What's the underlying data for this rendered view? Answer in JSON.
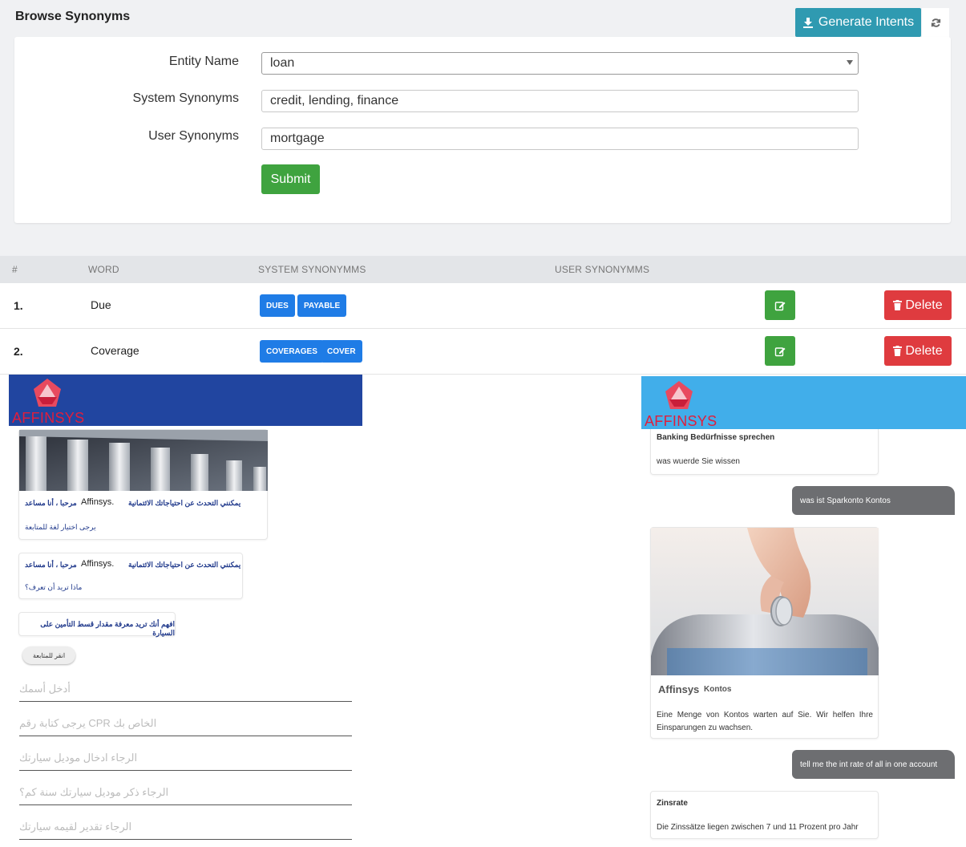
{
  "page": {
    "title": "Browse Synonyms",
    "generate_label": "Generate Intents"
  },
  "form": {
    "entity_label": "Entity Name",
    "entity_value": "loan",
    "system_label": "System Synonyms",
    "system_value": "credit, lending, finance",
    "user_label": "User Synonyms",
    "user_value": "mortgage",
    "submit_label": "Submit"
  },
  "table": {
    "headers": [
      "#",
      "WORD",
      "SYSTEM SYNONYMMS",
      "USER SYNONYMMS"
    ],
    "rows": [
      {
        "num": "1.",
        "word": "Due",
        "chips": [
          "DUES",
          "PAYABLE"
        ],
        "delete_label": "Delete"
      },
      {
        "num": "2.",
        "word": "Coverage",
        "chips": [
          "COVERAGES",
          "COVER"
        ],
        "delete_label": "Delete"
      }
    ]
  },
  "colors": {
    "arabic_header": "#2145a0",
    "german_header": "#41aeea",
    "logo_red": "#e01e3c",
    "primary": "#1f7ce6",
    "success": "#3fa33f",
    "danger": "#df3b3f",
    "teal": "#2f9ab1"
  },
  "chat_ar": {
    "logo": "AFFINSYS",
    "card1": {
      "line_a": "يمكنني التحدث عن احتياجاتك الائتمانية",
      "brand": "Affinsys.",
      "line_b": "مرحبا ، أنا مساعد",
      "line_c": "يرجى اختيار لغة للمتابعة"
    },
    "card2": {
      "line_a": "يمكنني التحدث عن احتياجاتك الائتمانية",
      "brand": "Affinsys.",
      "line_b": "مرحبا ، أنا مساعد",
      "line_c": "ماذا تريد أن تعرف؟"
    },
    "card3": "افهم أنك تريد معرفة مقدار قسط التأمين على السيارة",
    "pill": "انقر للمتابعة",
    "inputs": [
      "أدخل أسمك",
      "الخاص بك CPR يرجى كتابة رقم",
      "الرجاء ادخال موديل سيارتك",
      "الرجاء ذكر موديل سيارتك سنة كم؟",
      "الرجاء تقدير لقيمه سيارتك"
    ]
  },
  "chat_de": {
    "logo": "AFFINSYS",
    "card1_title": "Banking Bedürfnisse sprechen",
    "card1_text": "was wuerde Sie wissen",
    "user1": "was ist Sparkonto Kontos",
    "card2_brand": "Affinsys",
    "card2_sub": "Kontos",
    "card2_text": "Eine Menge von Kontos warten auf Sie. Wir helfen Ihre Einsparungen zu wachsen.",
    "user2": "tell me the int rate of all in one account",
    "card3_title": "Zinsrate",
    "card3_text": "Die Zinssätze liegen zwischen 7 und 11 Prozent pro Jahr"
  }
}
